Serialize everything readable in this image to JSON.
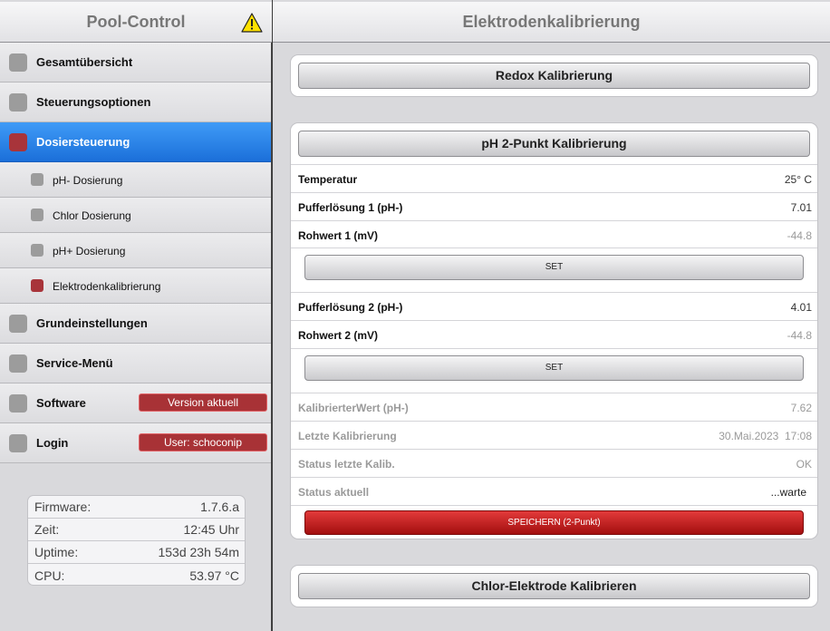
{
  "sidebar": {
    "title": "Pool-Control",
    "warning_icon": "warning-triangle-icon",
    "items": [
      {
        "label": "Gesamtübersicht"
      },
      {
        "label": "Steuerungsoptionen"
      },
      {
        "label": "Dosiersteuerung",
        "active": true
      },
      {
        "label": "Grundeinstellungen"
      },
      {
        "label": "Service-Menü"
      },
      {
        "label": "Software",
        "badge": "Version aktuell"
      },
      {
        "label": "Login",
        "badge": "User: schoconip"
      }
    ],
    "subitems": [
      {
        "label": "pH- Dosierung"
      },
      {
        "label": "Chlor Dosierung"
      },
      {
        "label": "pH+ Dosierung"
      },
      {
        "label": "Elektrodenkalibrierung",
        "active": true
      }
    ],
    "info": [
      {
        "label": "Firmware:",
        "value": "1.7.6.a"
      },
      {
        "label": "Zeit:",
        "value": "12:45 Uhr"
      },
      {
        "label": "Uptime:",
        "value": "153d 23h 54m"
      },
      {
        "label": "CPU:",
        "value": "53.97 °C"
      }
    ]
  },
  "main": {
    "title": "Elektrodenkalibrierung",
    "redox_button": "Redox Kalibrierung",
    "ph_button": "pH 2-Punkt Kalibrierung",
    "rows": {
      "temperatur": {
        "label": "Temperatur",
        "value": "25° C"
      },
      "puffer1": {
        "label": "Pufferlösung 1 (pH-)",
        "value": "7.01"
      },
      "rohwert1": {
        "label": "Rohwert 1 (mV)",
        "value": "-44.8"
      },
      "puffer2": {
        "label": "Pufferlösung 2 (pH-)",
        "value": "4.01"
      },
      "rohwert2": {
        "label": "Rohwert 2 (mV)",
        "value": "-44.8"
      },
      "kalibriert": {
        "label": "KalibrierterWert (pH-)",
        "value": "7.62"
      },
      "letzte": {
        "label": "Letzte Kalibrierung",
        "value": "30.Mai.2023  17:08"
      },
      "status_letzte": {
        "label": "Status letzte Kalib.",
        "value": "OK"
      },
      "status_aktuell": {
        "label": "Status aktuell",
        "value": "...warte"
      }
    },
    "set_label": "SET",
    "save_label": "SPEICHERN (2-Punkt)",
    "chlor_button": "Chlor-Elektrode Kalibrieren"
  }
}
